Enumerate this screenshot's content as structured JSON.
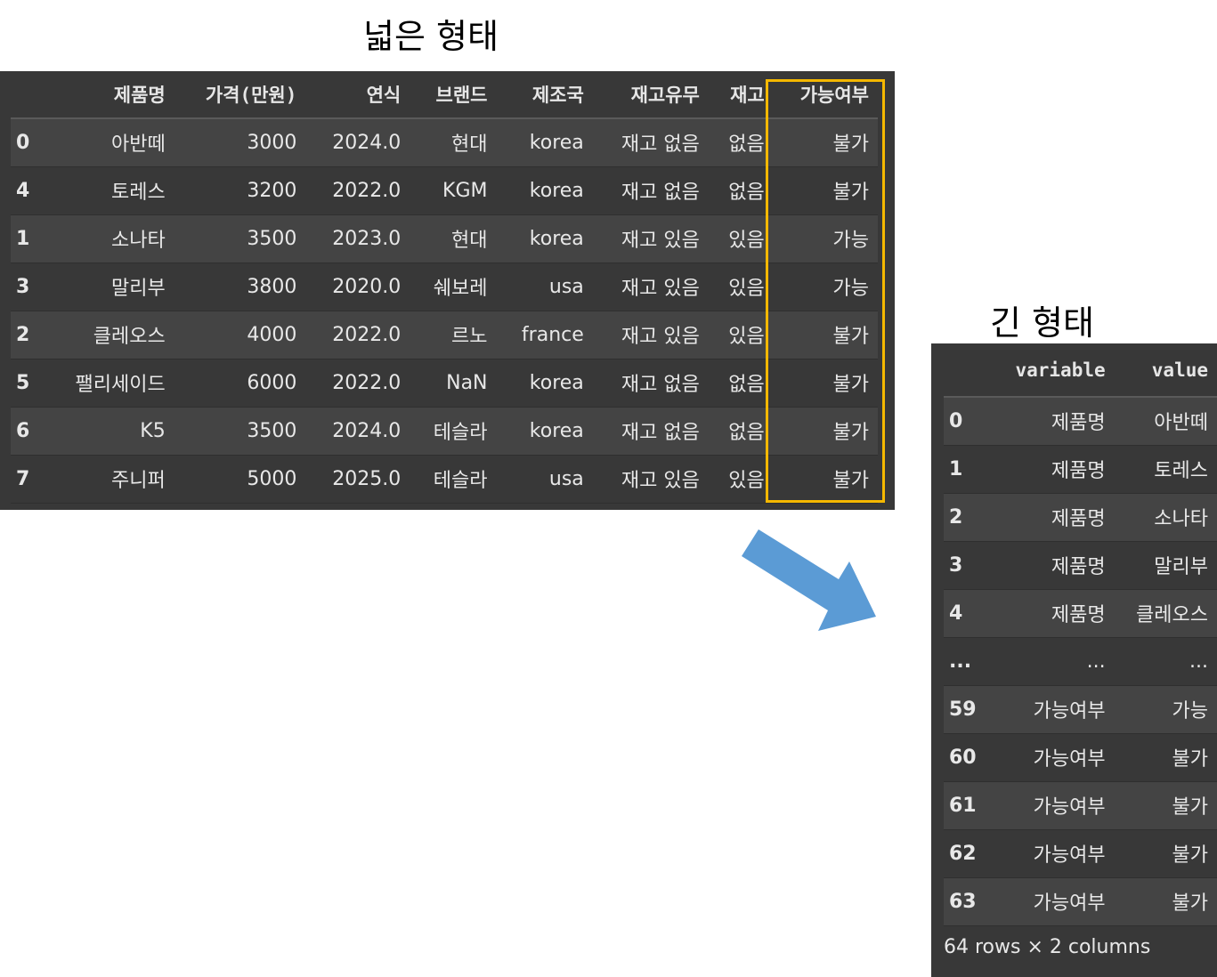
{
  "wide_caption": "넓은 형태",
  "long_caption": "긴 형태",
  "wide_table": {
    "columns": [
      "",
      "제품명",
      "가격(만원)",
      "연식",
      "브랜드",
      "제조국",
      "재고유무",
      "재고",
      "가능여부"
    ],
    "rows": [
      [
        "0",
        "아반떼",
        "3000",
        "2024.0",
        "현대",
        "korea",
        "재고 없음",
        "없음",
        "불가"
      ],
      [
        "4",
        "토레스",
        "3200",
        "2022.0",
        "KGM",
        "korea",
        "재고 없음",
        "없음",
        "불가"
      ],
      [
        "1",
        "소나타",
        "3500",
        "2023.0",
        "현대",
        "korea",
        "재고 있음",
        "있음",
        "가능"
      ],
      [
        "3",
        "말리부",
        "3800",
        "2020.0",
        "쉐보레",
        "usa",
        "재고 있음",
        "있음",
        "가능"
      ],
      [
        "2",
        "클레오스",
        "4000",
        "2022.0",
        "르노",
        "france",
        "재고 있음",
        "있음",
        "불가"
      ],
      [
        "5",
        "팰리세이드",
        "6000",
        "2022.0",
        "NaN",
        "korea",
        "재고 없음",
        "없음",
        "불가"
      ],
      [
        "6",
        "K5",
        "3500",
        "2024.0",
        "테슬라",
        "korea",
        "재고 없음",
        "없음",
        "불가"
      ],
      [
        "7",
        "주니퍼",
        "5000",
        "2025.0",
        "테슬라",
        "usa",
        "재고 있음",
        "있음",
        "불가"
      ]
    ]
  },
  "long_table": {
    "columns": [
      "",
      "variable",
      "value"
    ],
    "rows": [
      [
        "0",
        "제품명",
        "아반떼"
      ],
      [
        "1",
        "제품명",
        "토레스"
      ],
      [
        "2",
        "제품명",
        "소나타"
      ],
      [
        "3",
        "제품명",
        "말리부"
      ],
      [
        "4",
        "제품명",
        "클레오스"
      ],
      [
        "...",
        "...",
        "..."
      ],
      [
        "59",
        "가능여부",
        "가능"
      ],
      [
        "60",
        "가능여부",
        "불가"
      ],
      [
        "61",
        "가능여부",
        "불가"
      ],
      [
        "62",
        "가능여부",
        "불가"
      ],
      [
        "63",
        "가능여부",
        "불가"
      ]
    ],
    "footer": "64 rows × 2 columns"
  },
  "colors": {
    "highlight": "#f5b800",
    "arrow": "#5b9bd5",
    "panel_bg": "#383838"
  },
  "icons": {
    "arrow": "arrow-down-right-icon"
  }
}
